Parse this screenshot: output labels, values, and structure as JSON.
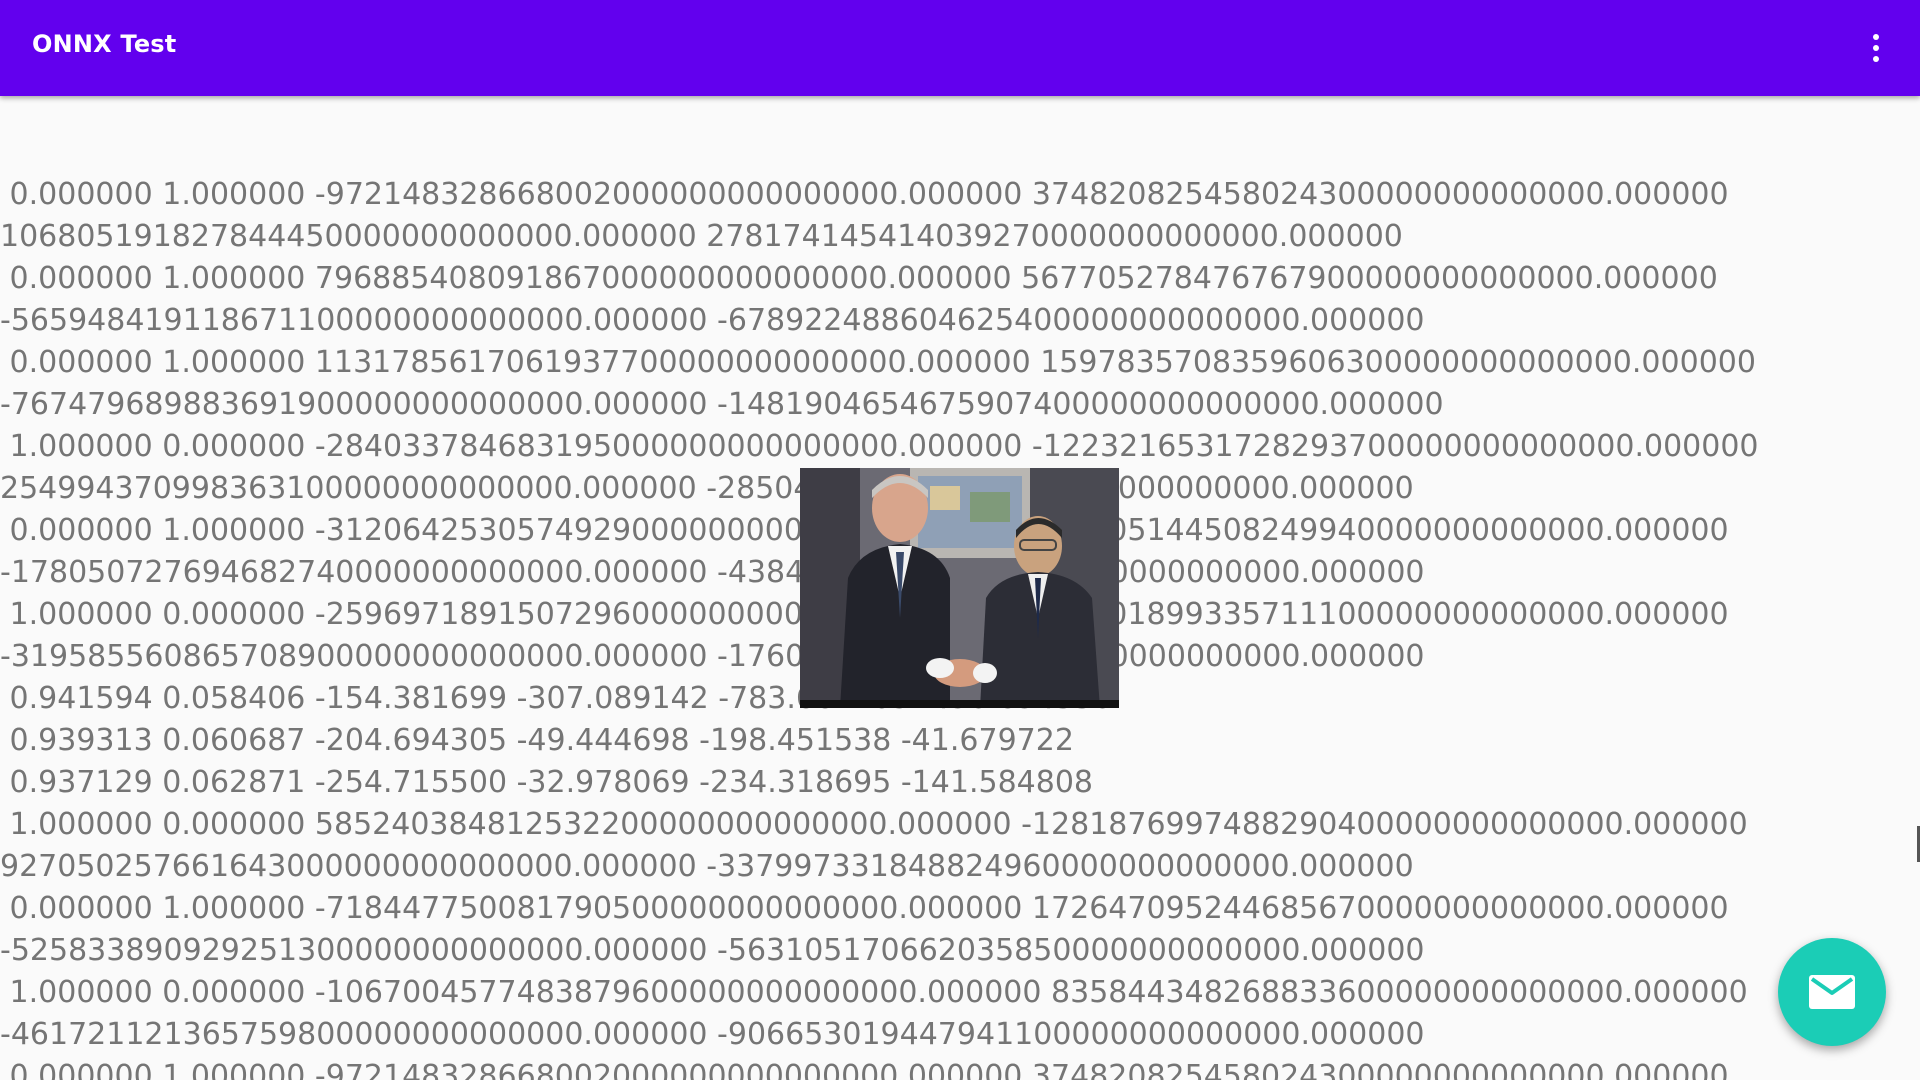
{
  "app_bar": {
    "title": "ONNX Test",
    "menu_icon": "more-vert-icon"
  },
  "output": {
    "lines": [
      " 0.000000 1.000000 -972148328668002000000000000000.000000 374820825458024300000000000000.000000",
      "106805191827844450000000000000.000000 278174145414039270000000000000.000000",
      " 0.000000 1.000000 796885408091867000000000000000.000000 567705278476767900000000000000.000000",
      "-565948419118671100000000000000.000000 -678922488604625400000000000000.000000",
      " 0.000000 1.000000 1131785617061937700000000000000.000000 1597835708359606300000000000000.000000",
      "-767479689883691900000000000000.000000 -1481904654675907400000000000000.000000",
      " 1.000000 0.000000 -284033784683195000000000000000.000000 -1223216531728293700000000000000.000000",
      "254994370998363100000000000000.000000 -285048557016179500000000000000.000000",
      " 0.000000 1.000000 -312064253057492900000000000000.000000 236005144508249940000000000000.000000",
      "-178050727694682740000000000000.000000 -438455924251669650000000000000.000000",
      " 1.000000 0.000000 -259697189150729600000000000000.000000 755701899335711100000000000000.000000",
      "-319585560865708900000000000000.000000 -176015972558431160000000000000.000000",
      " 0.941594 0.058406 -154.381699 -307.089142 -783.662109 -490.694550",
      " 0.939313 0.060687 -204.694305 -49.444698 -198.451538 -41.679722",
      " 0.937129 0.062871 -254.715500 -32.978069 -234.318695 -141.584808",
      " 1.000000 0.000000 585240384812532200000000000000.000000 -1281876997488290400000000000000.000000",
      "927050257661643000000000000000.000000 -337997331848824960000000000000.000000",
      " 0.000000 1.000000 -718447750081790500000000000000.000000 172647095244685670000000000000.000000",
      "-525833890929251300000000000000.000000 -563105170662035850000000000000.000000",
      " 1.000000 0.000000 -1067004577483879600000000000000.000000 835844348268833600000000000000.000000",
      "-461721121365759800000000000000.000000 -906653019447941100000000000000.000000",
      " 0.000000 1.000000 -972148328668002000000000000000.000000 374820825458024300000000000000.000000"
    ]
  },
  "image": {
    "alt": "photo-handshake"
  },
  "fab": {
    "icon": "email-icon"
  },
  "colors": {
    "primary": "#6200ee",
    "accent": "#1bcdb6",
    "text": "#757575",
    "background": "#fafafa"
  }
}
